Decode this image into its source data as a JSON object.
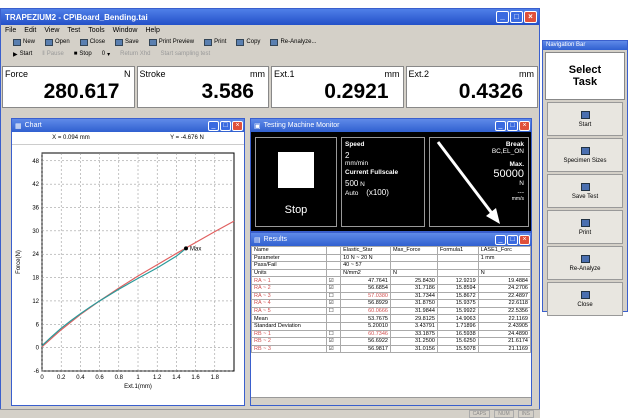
{
  "window": {
    "title": "TRAPEZIUM2  -  CP\\Board_Bending.tai"
  },
  "menu": [
    "File",
    "Edit",
    "View",
    "Test",
    "Tools",
    "Window",
    "Help"
  ],
  "toolbar": {
    "row1": [
      "New",
      "Open",
      "Close",
      "Save",
      "Print Preview",
      "Print",
      "Copy",
      "Re-Analyze..."
    ],
    "row2": [
      "Start",
      "Pause",
      "Stop",
      "Return Xhd",
      "Start sampling test"
    ],
    "stop_value": "0"
  },
  "readouts": [
    {
      "label": "Force",
      "unit": "N",
      "value": "280.617"
    },
    {
      "label": "Stroke",
      "unit": "mm",
      "value": "3.586"
    },
    {
      "label": "Ext.1",
      "unit": "mm",
      "value": "0.2921"
    },
    {
      "label": "Ext.2",
      "unit": "mm",
      "value": "0.4326"
    }
  ],
  "chart_panel": {
    "title": "Chart",
    "x_readout": "X = 0.094 mm",
    "y_readout": "Y = -4.676 N"
  },
  "chart_data": {
    "type": "line",
    "xlabel": "Ext.1(mm)",
    "ylabel": "Force(N)",
    "xlim": [
      0,
      2
    ],
    "ylim": [
      -6,
      50
    ],
    "x_ticks": [
      "0",
      "0.2",
      "0.4",
      "0.6",
      "0.8",
      "1",
      "1.2",
      "1.4",
      "1.6",
      "1.8"
    ],
    "y_ticks": [
      "-6",
      "0",
      "6",
      "12",
      "18",
      "24",
      "30",
      "36",
      "42",
      "48"
    ],
    "annotation": "Max",
    "series": [
      {
        "color": "#2a9a9a",
        "x": [
          0,
          0.1,
          0.2,
          0.3,
          0.4,
          0.5,
          0.6,
          0.8,
          1.0,
          1.2,
          1.4,
          1.5
        ],
        "y": [
          0.5,
          2.8,
          5.0,
          6.9,
          8.7,
          10.4,
          12.0,
          15.0,
          17.8,
          20.5,
          23.5,
          25.5
        ]
      },
      {
        "color": "#e06060",
        "x": [
          0,
          0.2,
          0.4,
          0.6,
          0.8,
          1.0,
          1.2,
          1.4,
          1.6,
          1.8,
          2.0
        ],
        "y": [
          0.2,
          4.6,
          8.5,
          12.0,
          15.3,
          18.4,
          21.3,
          24.2,
          27.0,
          29.8,
          32.5
        ]
      }
    ],
    "max_point": {
      "x": 1.5,
      "y": 25.5
    }
  },
  "monitor": {
    "title": "Testing Machine Monitor",
    "stop_label": "Stop",
    "speed_label": "Speed",
    "speed_value": "2",
    "speed_unit": "mm/min",
    "fullscale_label": "Current Fullscale",
    "fullscale_value": "500",
    "fullscale_unit": "N",
    "fullscale_mode": "Auto",
    "fullscale_mult": "(x100)",
    "break_label": "Break",
    "break_value": "BC,EL_ON",
    "max_label": "Max.",
    "max_value": "50000",
    "max_unit": "N",
    "max_rate": "---",
    "max_rate_unit": "mm/s"
  },
  "results": {
    "title": "Results",
    "columns": [
      "",
      "",
      "Elastic_Star",
      "Max_Force",
      "Formula1",
      "LASE1_Forc"
    ],
    "rows": [
      {
        "name": "Name",
        "check": "",
        "c1": "Elastic_Star",
        "c2": "Max_Force",
        "c3": "Formula1",
        "c4": "LASE1_Forc",
        "red": false
      },
      {
        "name": "Parameter",
        "check": "",
        "c1": "10 N ~ 20 N",
        "c2": "",
        "c3": "",
        "c4": "1 mm",
        "red": false
      },
      {
        "name": "Pass/Fail",
        "check": "",
        "c1": "40 ~ 57",
        "c2": "",
        "c3": "",
        "c4": "",
        "red": false
      },
      {
        "name": "Units",
        "check": "",
        "c1": "N/mm2",
        "c2": "N",
        "c3": "",
        "c4": "N",
        "red": false
      },
      {
        "name": "RA ~ 1",
        "check": "☑",
        "c1": "47.7641",
        "c2": "25.8430",
        "c3": "12.9219",
        "c4": "19.4884",
        "red": true
      },
      {
        "name": "RA ~ 2",
        "check": "☑",
        "c1": "56.6854",
        "c2": "31.7186",
        "c3": "15.8594",
        "c4": "24.2706",
        "red": true
      },
      {
        "name": "RA ~ 3",
        "check": "☐",
        "c1": "57.0380",
        "c2": "31.7344",
        "c3": "15.8672",
        "c4": "22.4897",
        "red": true
      },
      {
        "name": "RA ~ 4",
        "check": "☑",
        "c1": "56.8929",
        "c2": "31.8750",
        "c3": "15.9375",
        "c4": "22.6118",
        "red": true
      },
      {
        "name": "RA ~ 5",
        "check": "☐",
        "c1": "60.0666",
        "c2": "31.9844",
        "c3": "15.9922",
        "c4": "22.5356",
        "red": true
      },
      {
        "name": "Mean",
        "check": "",
        "c1": "53.7675",
        "c2": "29.8125",
        "c3": "14.9063",
        "c4": "22.1169",
        "red": false
      },
      {
        "name": "Standard Deviation",
        "check": "",
        "c1": "5.20010",
        "c2": "3.43791",
        "c3": "1.71896",
        "c4": "2.43905",
        "red": false
      },
      {
        "name": "RB ~ 1",
        "check": "☐",
        "c1": "60.7346",
        "c2": "33.1875",
        "c3": "16.5938",
        "c4": "24.4890",
        "red": true
      },
      {
        "name": "RB ~ 2",
        "check": "☑",
        "c1": "56.6922",
        "c2": "31.2500",
        "c3": "15.6250",
        "c4": "21.6174",
        "red": true
      },
      {
        "name": "RB ~ 3",
        "check": "☑",
        "c1": "56.9817",
        "c2": "31.0156",
        "c3": "15.5078",
        "c4": "21.1169",
        "red": true
      }
    ]
  },
  "nav": {
    "title": "Navigation Bar",
    "select": "Select\nTask",
    "buttons": [
      "Start",
      "Specimen Sizes",
      "Save Test",
      "Print",
      "Re-Analyze",
      "Close"
    ]
  },
  "status": [
    "CAPS",
    "NUM",
    "INS"
  ]
}
